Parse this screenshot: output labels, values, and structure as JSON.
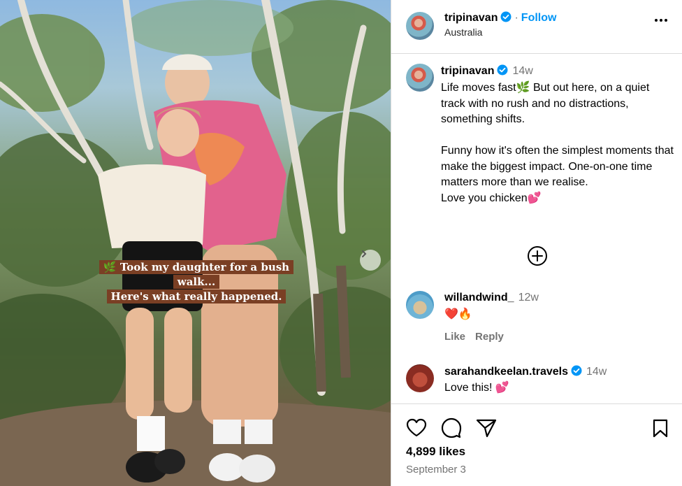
{
  "photo": {
    "caption_line1": "🌿 Took my daughter for a bush walk...",
    "caption_line2": "Here's what really happened."
  },
  "header": {
    "username": "tripinavan",
    "separator": "·",
    "follow_label": "Follow",
    "location": "Australia"
  },
  "post": {
    "username": "tripinavan",
    "time": "14w",
    "text": "Life moves fast🌿 But out here, on a quiet track with no rush and no distractions, something shifts.\n\nFunny how it's often the simplest moments that make the biggest impact. One-on-one time matters more than we realise.\nLove you chicken💕"
  },
  "comments": [
    {
      "username": "willandwind_",
      "time": "12w",
      "text": "❤️🔥",
      "like_label": "Like",
      "reply_label": "Reply"
    },
    {
      "username": "sarahandkeelan.travels",
      "time": "14w",
      "text": "Love this! 💕"
    }
  ],
  "footer": {
    "likes": "4,899 likes",
    "date": "September 3"
  },
  "colors": {
    "accent": "#0095f6",
    "verified": "#0095f6",
    "caption_bg": "#7a3f24",
    "muted": "#737373"
  }
}
